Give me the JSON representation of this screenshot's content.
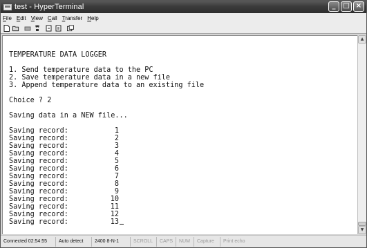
{
  "window": {
    "title": "test - HyperTerminal"
  },
  "title_buttons": {
    "minimize": "_",
    "maximize": "□",
    "close": "×"
  },
  "menu": [
    {
      "accel": "F",
      "rest": "ile"
    },
    {
      "accel": "E",
      "rest": "dit"
    },
    {
      "accel": "V",
      "rest": "iew"
    },
    {
      "accel": "C",
      "rest": "all"
    },
    {
      "accel": "T",
      "rest": "ransfer"
    },
    {
      "accel": "H",
      "rest": "elp"
    }
  ],
  "toolbar": {
    "icons": [
      "new-icon",
      "open-icon",
      "disconnect-icon",
      "call-icon",
      "send-icon",
      "receive-icon",
      "properties-icon"
    ]
  },
  "terminal": {
    "header": "TEMPERATURE DATA LOGGER",
    "options": [
      "1. Send temperature data to the PC",
      "2. Save temperature data in a new file",
      "3. Append temperature data to an existing file"
    ],
    "choice": "Choice ? 2",
    "saving_message": "Saving data in a NEW file...",
    "record_label": "Saving record:",
    "records": [
      "1",
      "2",
      "3",
      "4",
      "5",
      "6",
      "7",
      "8",
      "9",
      "10",
      "11",
      "12",
      "13"
    ]
  },
  "status": {
    "connected": "Connected 02:54:55",
    "detect": "Auto detect",
    "settings": "2400 8-N-1",
    "scroll": "SCROLL",
    "caps": "CAPS",
    "num": "NUM",
    "capture": "Capture",
    "print_echo": "Print echo"
  }
}
